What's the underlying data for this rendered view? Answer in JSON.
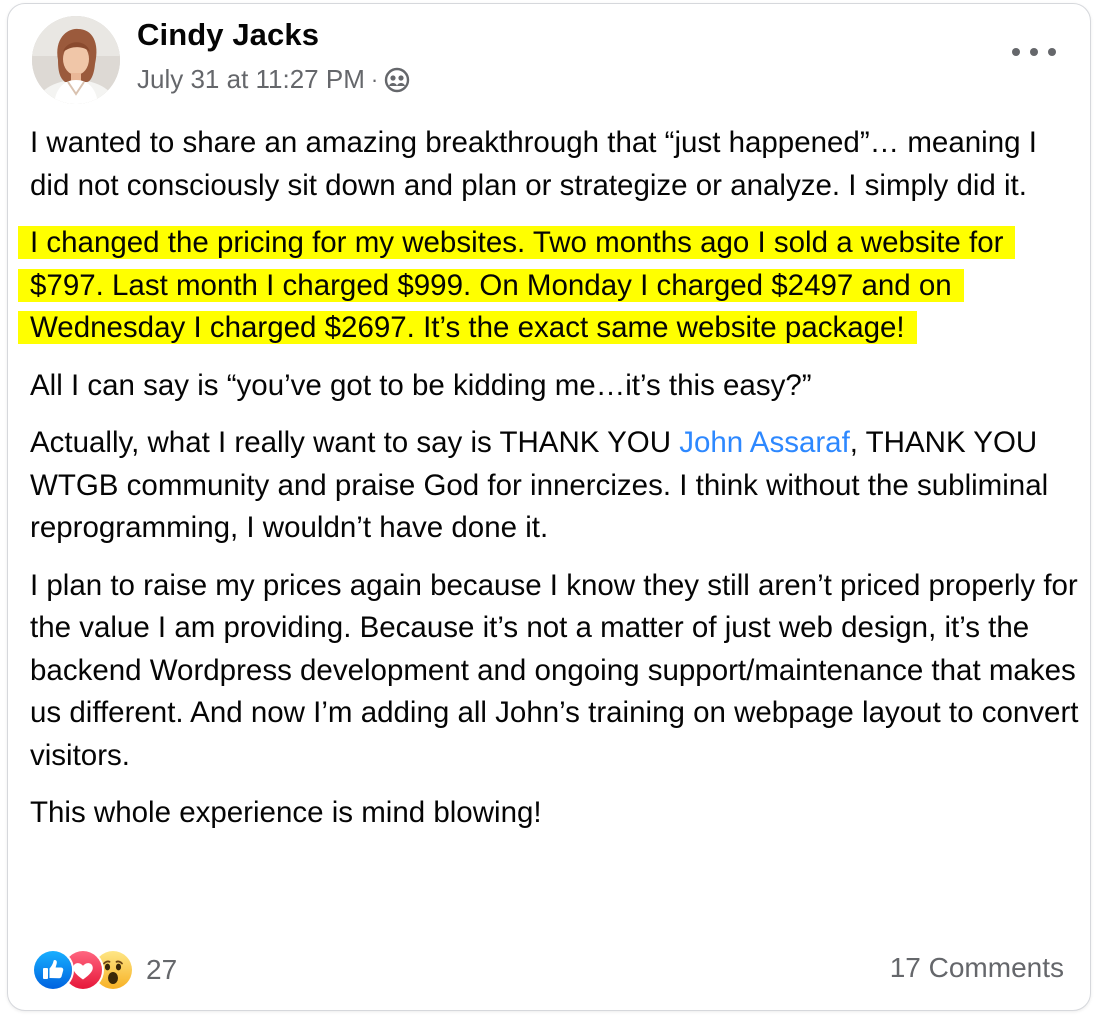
{
  "post": {
    "author": "Cindy Jacks",
    "timestamp": "July 31 at 11:27 PM",
    "separator": "·",
    "audience_icon": "members-group-icon",
    "more_icon": "more-options-icon",
    "paragraphs": {
      "p1": "I wanted to share an amazing breakthrough that “just happened”… meaning I did not consciously sit down and plan or strategize or analyze. I simply did it.",
      "p2": "I changed the pricing for my websites. Two months ago I sold a website for $797. Last month I charged $999. On Monday I charged $2497 and on Wednesday I charged $2697. It’s the exact same website package!",
      "p3": "All I can say is “you’ve got to be kidding me…it’s this easy?”",
      "p4_before": "Actually, what I really want to say is THANK YOU ",
      "p4_mention": "John Assaraf",
      "p4_after": ", THANK YOU WTGB community and praise God for innercizes. I think without the subliminal reprogramming, I wouldn’t have done it.",
      "p5": "I plan to raise my prices again because I know they still aren’t priced properly for the value I am providing. Because it’s not a matter of just web design, it’s the backend Wordpress development and ongoing support/maintenance that makes us different. And now I’m adding all John’s training on webpage layout to convert visitors.",
      "p6": "This whole experience is mind blowing!"
    },
    "highlight_color": "#ffff00",
    "mention_color": "#2d88ff",
    "reactions": {
      "icons": [
        "like-icon",
        "love-icon",
        "wow-icon"
      ],
      "count": "27"
    },
    "comments_label": "17 Comments"
  }
}
